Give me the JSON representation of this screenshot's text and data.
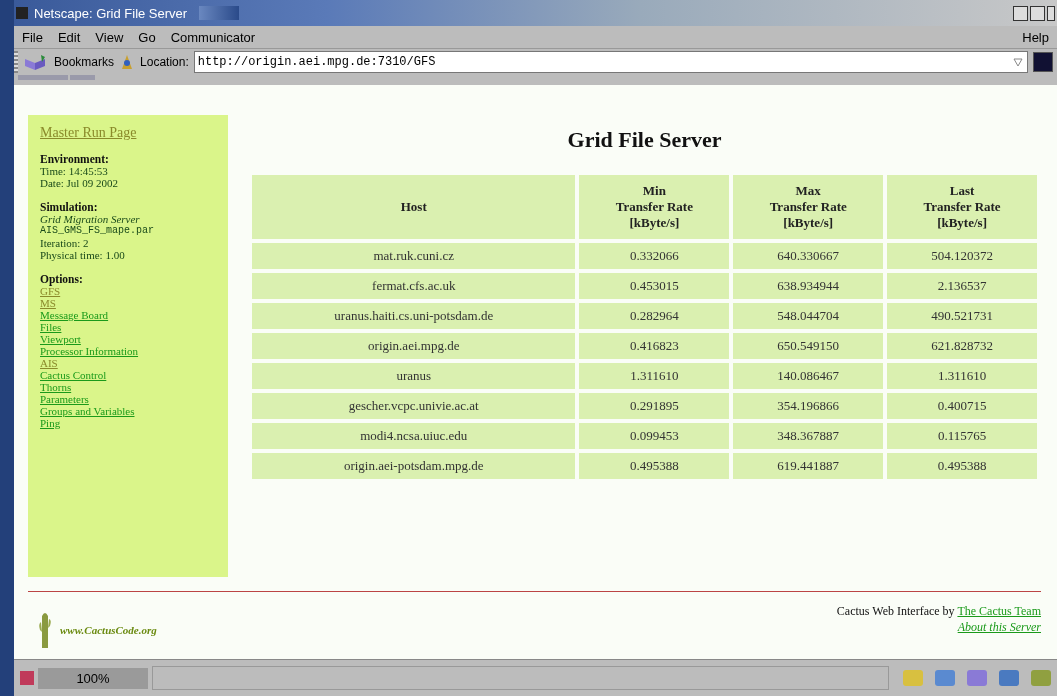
{
  "window": {
    "title": "Netscape: Grid File Server"
  },
  "menu": [
    "File",
    "Edit",
    "View",
    "Go",
    "Communicator"
  ],
  "help_menu": "Help",
  "location_bar": {
    "bookmarks": "Bookmarks",
    "location_label": "Location:",
    "url": "http://origin.aei.mpg.de:7310/GFS"
  },
  "sidebar": {
    "master_link": {
      "label": "Master Run Page",
      "visited": true
    },
    "environment": {
      "heading": "Environment:",
      "lines": [
        "Time: 14:45:53",
        "Date: Jul 09 2002"
      ]
    },
    "simulation": {
      "heading": "Simulation:",
      "name": "Grid Migration Server",
      "parfile": "AIS_GMS_FS_mape.par",
      "lines": [
        "Iteration: 2",
        "Physical time: 1.00"
      ]
    },
    "options": {
      "heading": "Options:",
      "links": [
        {
          "label": "GFS",
          "visited": true
        },
        {
          "label": "MS",
          "visited": true
        },
        {
          "label": "Message Board",
          "visited": false
        },
        {
          "label": "Files",
          "visited": false
        },
        {
          "label": "Viewport",
          "visited": false
        },
        {
          "label": "Processor Information",
          "visited": false
        },
        {
          "label": "AIS",
          "visited": true
        },
        {
          "label": "Cactus Control",
          "visited": false
        },
        {
          "label": "Thorns",
          "visited": false
        },
        {
          "label": "Parameters",
          "visited": false
        },
        {
          "label": "Groups and Variables",
          "visited": false
        },
        {
          "label": "Ping",
          "visited": false
        }
      ]
    }
  },
  "page_title": "Grid File Server",
  "table": {
    "columns": [
      "Host",
      "Min\nTransfer Rate\n[kByte/s]",
      "Max\nTransfer Rate\n[kByte/s]",
      "Last\nTransfer Rate\n[kByte/s]"
    ],
    "rows": [
      [
        "mat.ruk.cuni.cz",
        "0.332066",
        "640.330667",
        "504.120372"
      ],
      [
        "fermat.cfs.ac.uk",
        "0.453015",
        "638.934944",
        "2.136537"
      ],
      [
        "uranus.haiti.cs.uni-potsdam.de",
        "0.282964",
        "548.044704",
        "490.521731"
      ],
      [
        "origin.aei.mpg.de",
        "0.416823",
        "650.549150",
        "621.828732"
      ],
      [
        "uranus",
        "1.311610",
        "140.086467",
        "1.311610"
      ],
      [
        "gescher.vcpc.univie.ac.at",
        "0.291895",
        "354.196866",
        "0.400715"
      ],
      [
        "modi4.ncsa.uiuc.edu",
        "0.099453",
        "348.367887",
        "0.115765"
      ],
      [
        "origin.aei-potsdam.mpg.de",
        "0.495388",
        "619.441887",
        "0.495388"
      ]
    ]
  },
  "footer": {
    "logo": "www.CactusCode.org",
    "credit": "Cactus Web Interface by",
    "team_link": "The Cactus Team",
    "about_link": "About this Server"
  },
  "status_bar": {
    "zoom": "100%"
  }
}
